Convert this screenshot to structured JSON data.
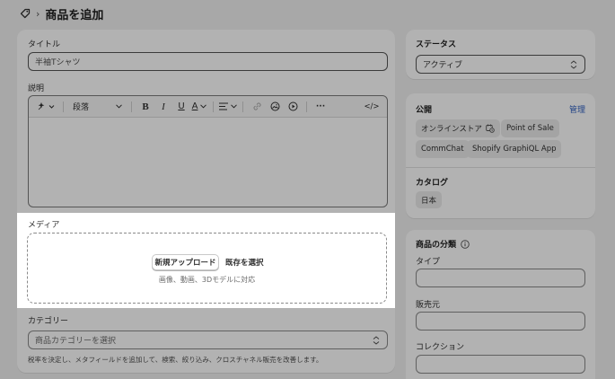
{
  "header": {
    "separator": "›",
    "title": "商品を追加"
  },
  "main": {
    "title_label": "タイトル",
    "title_value": "半袖Tシャツ",
    "description_label": "説明",
    "toolbar": {
      "paragraph_label": "段落",
      "bold": "B",
      "italic": "I",
      "underline": "U",
      "text_color": "A",
      "more": "···",
      "code": "</>"
    },
    "media": {
      "label": "メディア",
      "upload_button": "新規アップロード",
      "select_existing": "既存を選択",
      "hint": "画像、動画、3Dモデルに対応"
    },
    "category": {
      "label": "カテゴリー",
      "placeholder": "商品カテゴリーを選択",
      "help": "税率を決定し、メタフィールドを追加して、検索、絞り込み、クロスチャネル販売を改善します。"
    }
  },
  "status": {
    "label": "ステータス",
    "value": "アクティブ"
  },
  "publishing": {
    "label": "公開",
    "manage_link": "管理",
    "channels": [
      "オンラインストア",
      "Point of Sale",
      "CommChat",
      "Shopify GraphiQL App"
    ],
    "catalog_label": "カタログ",
    "catalogs": [
      "日本"
    ]
  },
  "organization": {
    "label": "商品の分類",
    "type_label": "タイプ",
    "vendor_label": "販売元",
    "collections_label": "コレクション"
  },
  "colors": {
    "overlay": "rgba(0,0,0,0.30)",
    "link": "#2e5fc0"
  }
}
